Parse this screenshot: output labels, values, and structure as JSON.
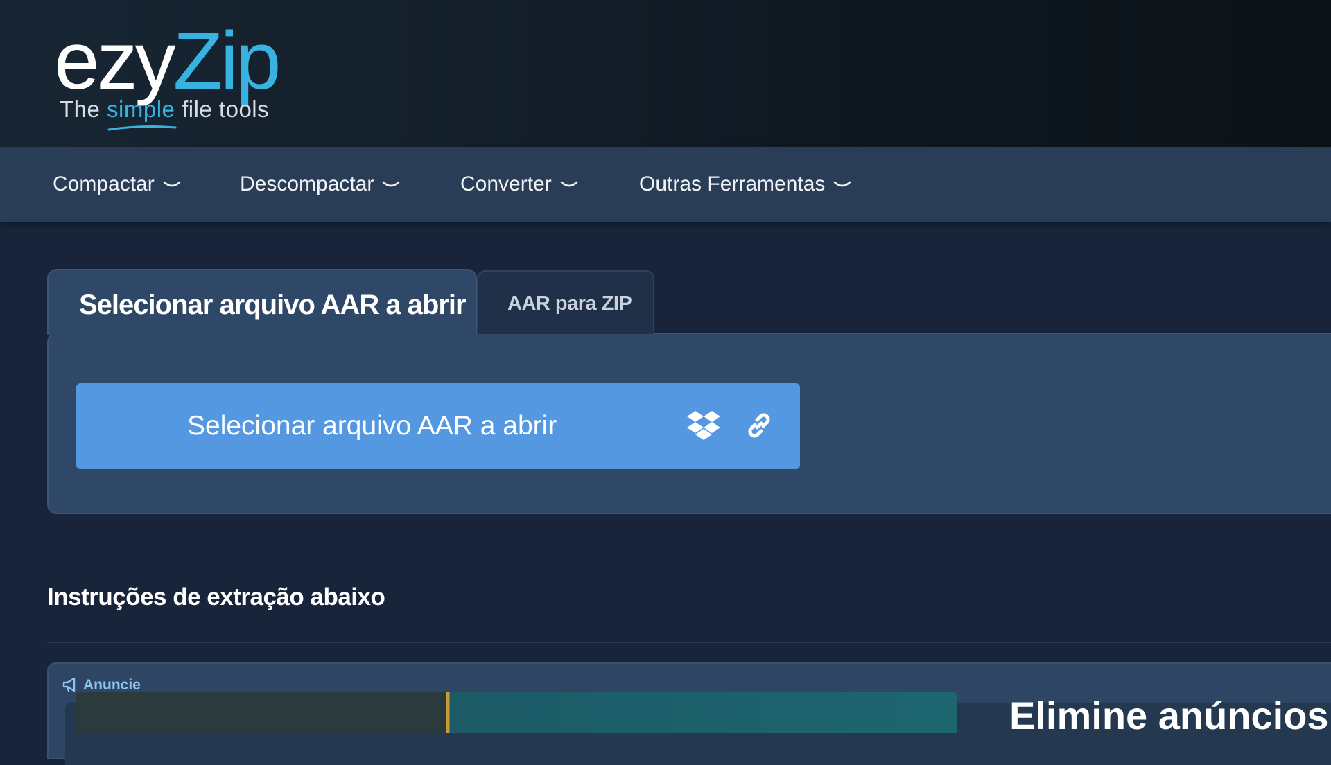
{
  "logo": {
    "word_main": "ezy",
    "word_accent": "Zip",
    "tagline_before": "The ",
    "tagline_accent": "simple",
    "tagline_after": " file tools"
  },
  "nav": {
    "items": [
      {
        "label": "Compactar",
        "icon": "chevron-down-icon"
      },
      {
        "label": "Descompactar",
        "icon": "chevron-down-icon"
      },
      {
        "label": "Converter",
        "icon": "chevron-down-icon"
      },
      {
        "label": "Outras Ferramentas",
        "icon": "chevron-down-icon"
      }
    ]
  },
  "tabs": {
    "active_label": "Selecionar arquivo AAR a abrir",
    "other_label": "AAR para ZIP"
  },
  "select_button": {
    "label": "Selecionar arquivo AAR a abrir",
    "dropbox_icon": "dropbox-icon",
    "link_icon": "link-icon"
  },
  "instructions": {
    "heading": "Instruções de extração abaixo"
  },
  "ad": {
    "label": "Anuncie",
    "label_icon": "megaphone-icon",
    "headline": "Elimine anúncios c"
  },
  "colors": {
    "header_bg": "#0f1922",
    "nav_bg": "#2a3d56",
    "page_bg": "#17243a",
    "card_bg": "#2f4868",
    "button_bg": "#5498e2",
    "brand_accent": "#38b3e0"
  }
}
